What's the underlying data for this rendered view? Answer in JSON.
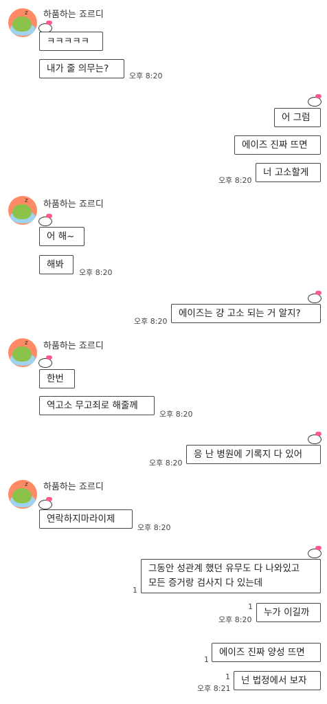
{
  "contact": {
    "name": "하품하는 죠르디"
  },
  "messages": {
    "m1": "ㅋㅋㅋㅋㅋ",
    "m2": "내가 줄 의무는?",
    "m3": "어 그럼",
    "m4": "에이즈 진짜 뜨면",
    "m5": "너 고소할게",
    "m6": "어 해~",
    "m7": "해봐",
    "m8": "에이즈는 걍 고소 되는 거 알지?",
    "m9": "한번",
    "m10": "역고소 무고죄로 해줄께",
    "m11": "응 난 병원에 기록지 다 있어",
    "m12": "연락하지마라이제",
    "m13a": "그동안 성관계 했던 유무도 다 나와있고",
    "m13b": "모든 증거랑 검사지 다 있는데",
    "m14": "누가 이길까",
    "m15": "에이즈 진짜 양성 뜨면",
    "m16": "넌 법정에서 보자"
  },
  "times": {
    "t1": "오후 8:20",
    "t2": "오후 8:20",
    "t3": "오후 8:20",
    "t4": "오후 8:20",
    "t5": "오후 8:20",
    "t6": "오후 8:20",
    "t7": "오후 8:20",
    "t8": "오후 8:20",
    "t9": "오후 8:21"
  },
  "unread": {
    "u": "1"
  }
}
